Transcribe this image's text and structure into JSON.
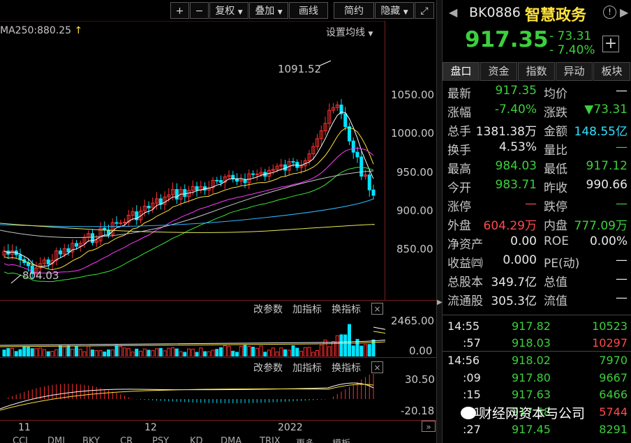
{
  "toolbar": {
    "zoom_in": "+",
    "zoom_out": "−",
    "adjust": "复权",
    "overlay": "叠加",
    "draw": "画线",
    "brief": "简约",
    "hide": "隐藏",
    "expand": "⤢"
  },
  "main_chart": {
    "ma_label": "MA250:880.25",
    "settings_label": "设置均线",
    "high_annotation": "1091.52",
    "low_annotation": "804.03",
    "y_ticks": [
      "1050.00",
      "1000.00",
      "950.00",
      "900.00",
      "850.00"
    ],
    "x_ticks": [
      "11",
      "12",
      "2022"
    ]
  },
  "volume_panel": {
    "header": [
      "改参数",
      "加指标",
      "换指标"
    ],
    "close": "×",
    "y_ticks": [
      "2465.00",
      "0.00"
    ]
  },
  "macd_panel": {
    "header": [
      "改参数",
      "加指标",
      "换指标"
    ],
    "close": "×",
    "y_ticks": [
      "30.50",
      "-20.18"
    ]
  },
  "bottom_tabs": [
    "CCI",
    "DMI",
    "BKY",
    "CR",
    "PSY",
    "KD",
    "DMA",
    "TRIX",
    "更多",
    "模板"
  ],
  "colors": {
    "up": "#ff3030",
    "down": "#00e5ff",
    "ma5": "#ffffff",
    "ma10": "#ffe23b",
    "ma20": "#ff3bff",
    "ma30": "#38e838",
    "ma60": "#c8c8c8",
    "ma120": "#2fb7ff",
    "ma250": "#e8e85a"
  },
  "header": {
    "code": "BK0886",
    "name": "智慧政务",
    "price": "917.35",
    "change": "- 73.31",
    "change_pct": "- 7.40%",
    "add": "+"
  },
  "tabs": [
    "盘口",
    "资金",
    "指数",
    "异动",
    "板块"
  ],
  "quote_rows": [
    {
      "l1": "最新",
      "v1": "917.35",
      "c1": "green",
      "l2": "均价",
      "v2": "—",
      "c2": "white"
    },
    {
      "l1": "涨幅",
      "v1": "-7.40%",
      "c1": "green",
      "l2": "涨跌",
      "v2": "▼73.31",
      "c2": "green"
    },
    {
      "l1": "总手",
      "v1": "1381.38万",
      "c1": "white",
      "l2": "金额",
      "v2": "148.55亿",
      "c2": "cyan"
    },
    {
      "l1": "换手",
      "v1": "4.53%",
      "c1": "white",
      "l2": "量比",
      "v2": "—",
      "c2": "green"
    },
    {
      "l1": "最高",
      "v1": "984.03",
      "c1": "green",
      "l2": "最低",
      "v2": "917.12",
      "c2": "green"
    },
    {
      "l1": "今开",
      "v1": "983.71",
      "c1": "green",
      "l2": "昨收",
      "v2": "990.66",
      "c2": "white"
    },
    {
      "l1": "涨停",
      "v1": "—",
      "c1": "red",
      "l2": "跌停",
      "v2": "—",
      "c2": "green"
    },
    {
      "l1": "外盘",
      "v1": "604.29万",
      "c1": "red",
      "l2": "内盘",
      "v2": "777.09万",
      "c2": "green"
    },
    {
      "l1": "净资产",
      "v1": "0.00",
      "c1": "white",
      "l2": "ROE",
      "v2": "0.00%",
      "c2": "white"
    },
    {
      "l1": "收益㈣",
      "v1": "0.000",
      "c1": "white",
      "l2": "PE(动)",
      "v2": "—",
      "c2": "white"
    },
    {
      "l1": "总股本",
      "v1": "349.7亿",
      "c1": "white",
      "l2": "总值",
      "v2": "—",
      "c2": "white"
    },
    {
      "l1": "流通股",
      "v1": "305.3亿",
      "c1": "white",
      "l2": "流值",
      "v2": "—",
      "c2": "white"
    }
  ],
  "ticks": [
    {
      "time": "14:55",
      "price": "917.82",
      "vol": "10523",
      "vc": "green"
    },
    {
      "time": ":57",
      "price": "918.03",
      "vol": "10297",
      "vc": "red"
    },
    {
      "time": "14:56",
      "price": "918.02",
      "vol": "7970",
      "vc": "green"
    },
    {
      "time": ":09",
      "price": "917.80",
      "vol": "9667",
      "vc": "green"
    },
    {
      "time": ":15",
      "price": "917.63",
      "vol": "6466",
      "vc": "green"
    },
    {
      "time": ":21",
      "price": "917.58",
      "vol": "5744",
      "vc": "red"
    },
    {
      "time": ":27",
      "price": "917.45",
      "vol": "8291",
      "vc": "green"
    }
  ],
  "watermark": "财经网资本与公司"
}
